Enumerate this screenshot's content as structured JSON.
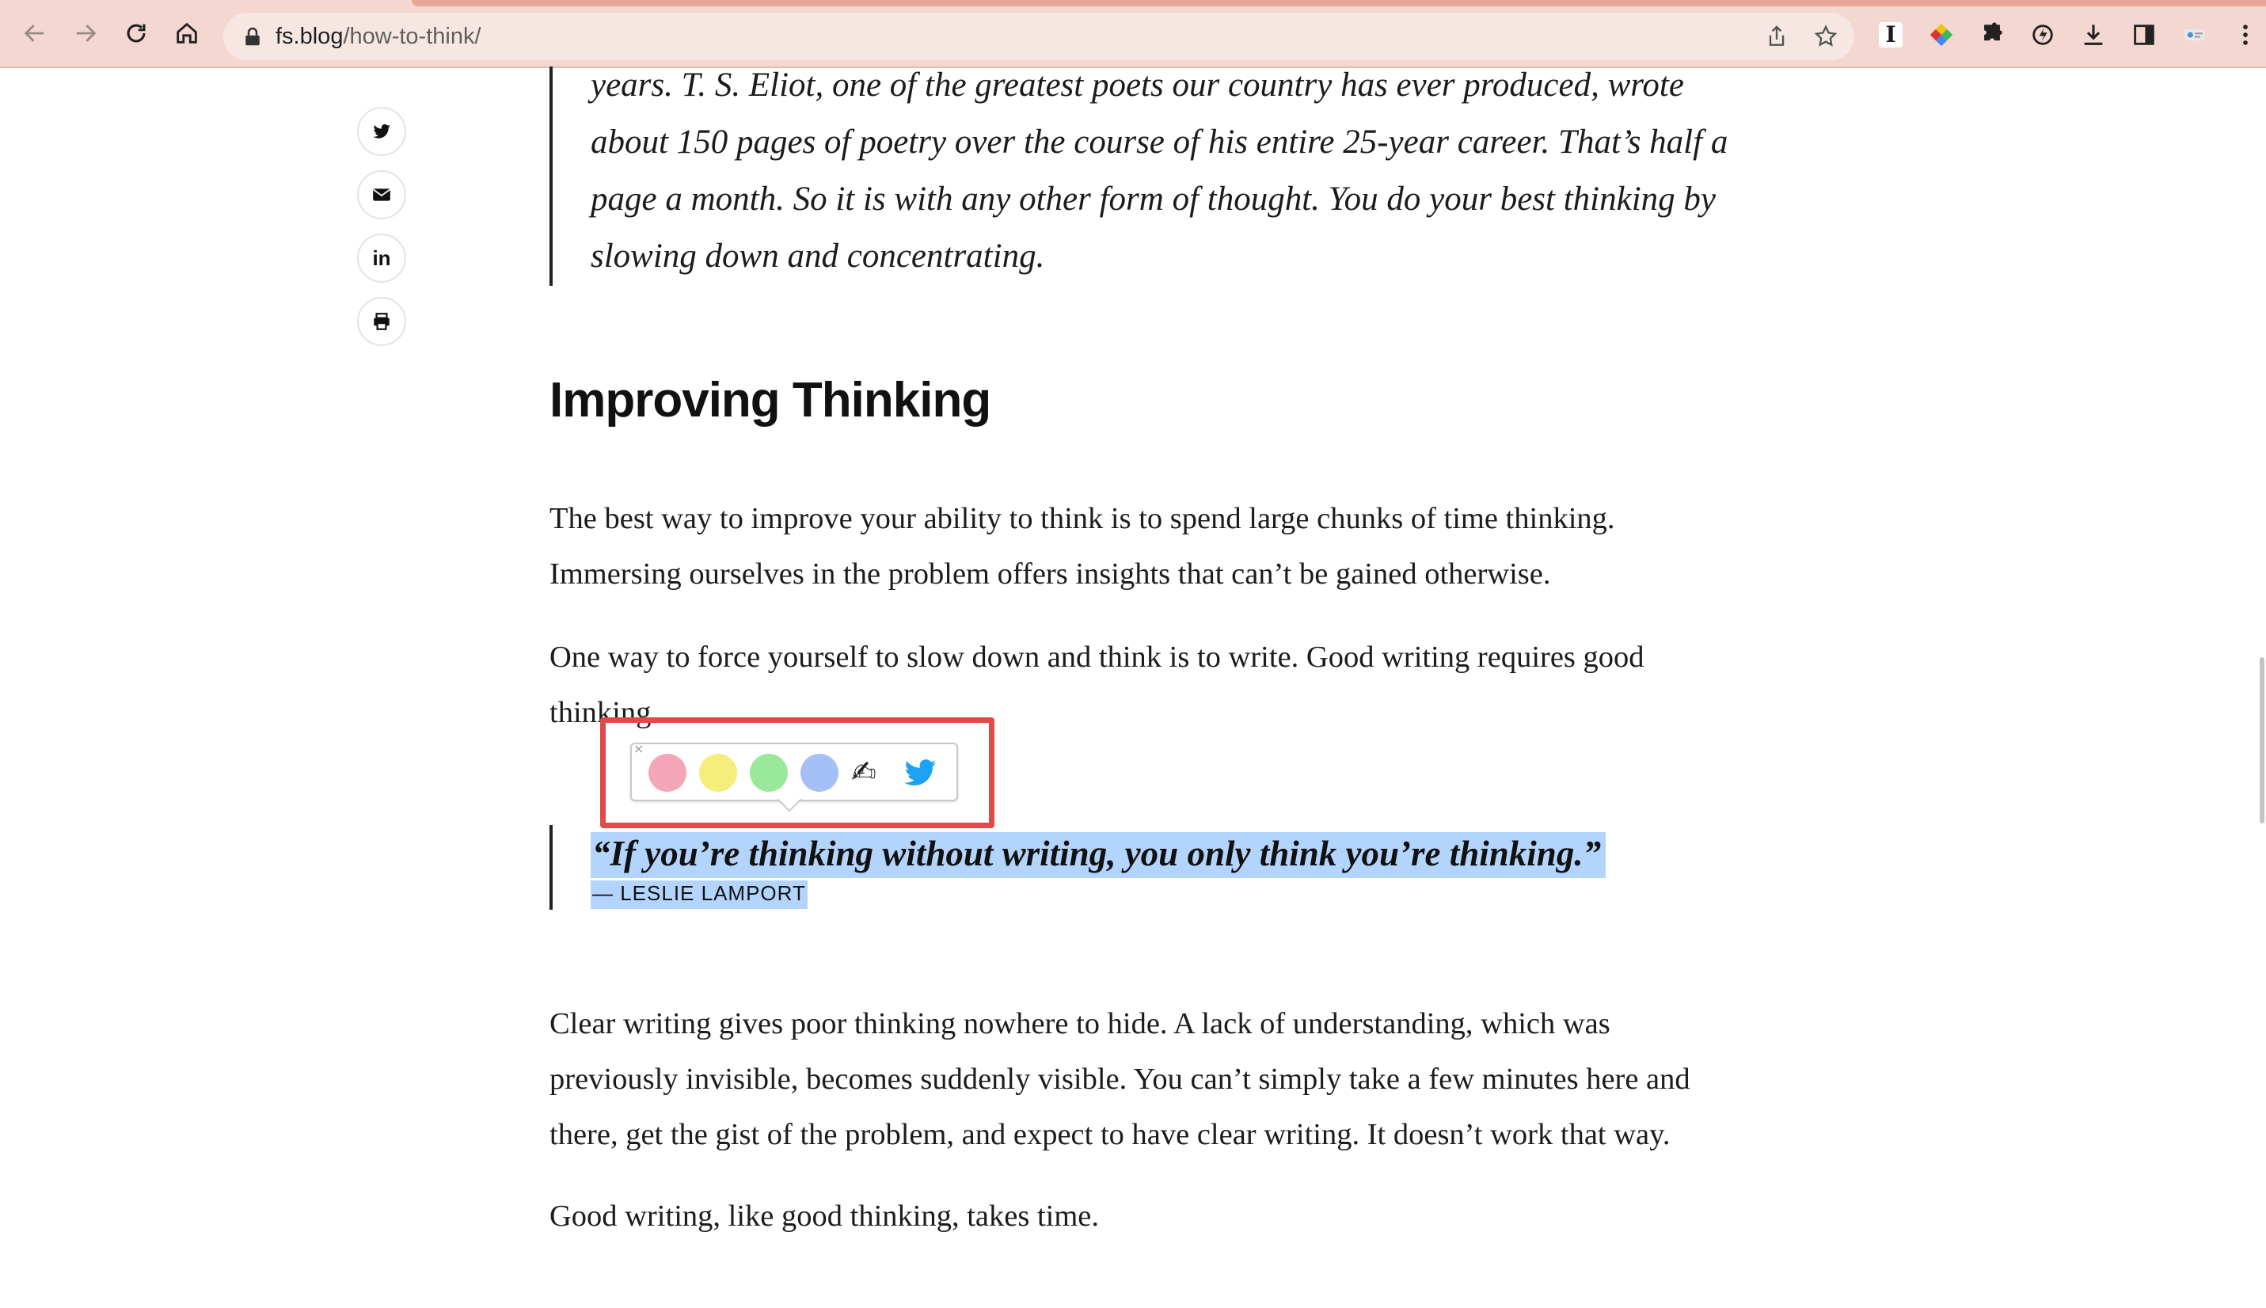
{
  "browser": {
    "url_domain": "fs.blog",
    "url_path": "/how-to-think/",
    "extensions": [
      "instapaper-icon",
      "color-tag-icon",
      "puzzle-icon",
      "sync-icon",
      "download-icon",
      "sidebar-icon",
      "profile-icon"
    ],
    "extension_i_label": "I"
  },
  "share": {
    "items": [
      "twitter-icon",
      "email-icon",
      "linkedin-icon",
      "print-icon"
    ],
    "linkedin_label": "in"
  },
  "article": {
    "quote_top": "years. T. S. Eliot, one of the greatest poets our country has ever produced, wrote about 150 pages of poetry over the course of his entire 25-year career. That’s half a page a month. So it is with any other form of thought. You do your best thinking by slowing down and concentrating.",
    "heading": "Improving Thinking",
    "para1": "The best way to improve your ability to think is to spend large chunks of time thinking. Immersing ourselves in the problem offers insights that can’t be gained otherwise.",
    "para2": "One way to force yourself to slow down and think is to write. Good writing requires good thinking.",
    "pull_quote": "“If you’re thinking without writing, you only think you’re thinking.”",
    "attribution": "— LESLIE LAMPORT",
    "para3": "Clear writing gives poor thinking nowhere to hide. A lack of understanding, which was previously invisible, becomes suddenly visible. You can’t simply take a few minutes here and there, get the gist of the problem, and expect to have clear writing. It doesn’t work that way.",
    "para4": "Good writing, like good thinking, takes time."
  },
  "highlighter_popup": {
    "close_label": "×",
    "colors": [
      {
        "name": "pink",
        "hex": "#f4a6b8"
      },
      {
        "name": "yellow",
        "hex": "#f5ee7a"
      },
      {
        "name": "green",
        "hex": "#9ae89a"
      },
      {
        "name": "blue",
        "hex": "#a5bff7"
      }
    ],
    "note_icon": "✍",
    "share_icon": "twitter-icon"
  },
  "colors": {
    "selection": "#b3d4fc",
    "popup_outline": "#e04a4a",
    "twitter": "#1da1f2"
  }
}
